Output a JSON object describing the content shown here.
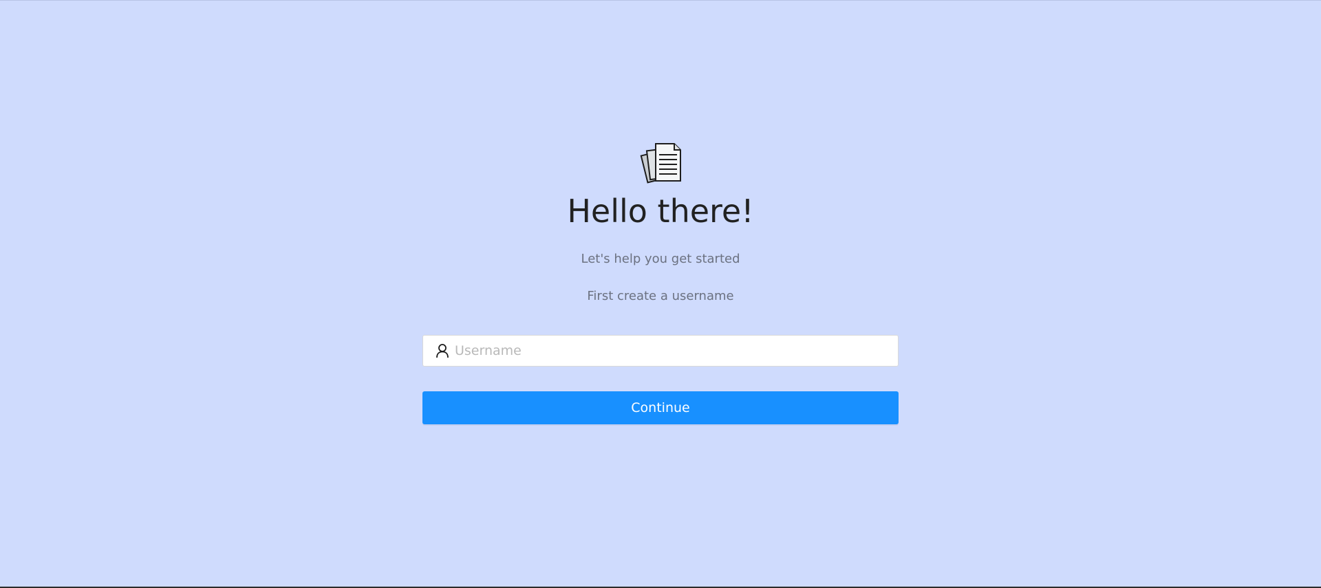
{
  "onboarding": {
    "logo_icon": "documents-icon",
    "title": "Hello there!",
    "subtitle": "Let's help you get started",
    "instruction": "First create a username",
    "username_placeholder": "Username",
    "username_value": "",
    "user_icon": "user-icon",
    "continue_label": "Continue"
  },
  "colors": {
    "background": "#cfdbfd",
    "primary_button": "#1890ff",
    "title_text": "#212121",
    "secondary_text": "#6b7180"
  }
}
